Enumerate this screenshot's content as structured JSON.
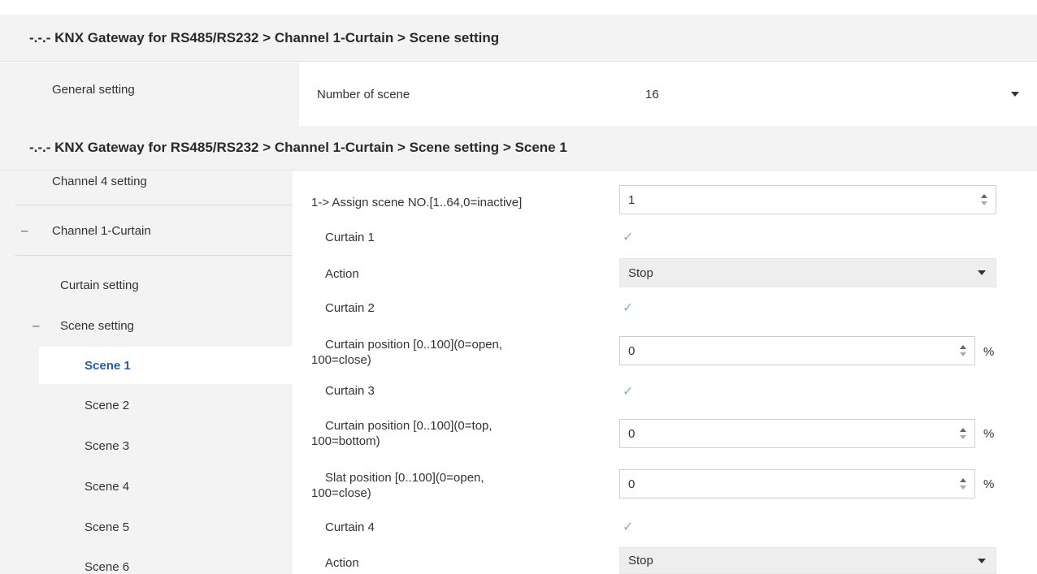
{
  "header1": "-.-.- KNX Gateway for RS485/RS232 > Channel 1-Curtain > Scene setting",
  "header2": "-.-.- KNX Gateway for RS485/RS232 > Channel 1-Curtain > Scene setting > Scene 1",
  "top_panel": {
    "sidebar_item": "General setting",
    "number_of_scene_label": "Number of scene",
    "number_of_scene_value": "16"
  },
  "sidebar": {
    "channel4": "Channel 4 setting",
    "channel1_toggle": "–",
    "channel1": "Channel 1-Curtain",
    "curtain_setting": "Curtain setting",
    "scene_setting_toggle": "–",
    "scene_setting": "Scene setting",
    "scenes": [
      "Scene 1",
      "Scene 2",
      "Scene 3",
      "Scene 4",
      "Scene 5",
      "Scene 6"
    ]
  },
  "params": {
    "assign_label": "1-> Assign scene NO.[1..64,0=inactive]",
    "assign_value": "1",
    "curtain1_label": "Curtain 1",
    "action1_label": "Action",
    "action1_value": "Stop",
    "curtain2_label": "Curtain 2",
    "c2_pos_label_1": "Curtain position [0..100](0=open,",
    "c2_pos_label_2": "100=close)",
    "c2_pos_value": "0",
    "curtain3_label": "Curtain 3",
    "c3_pos_label_1": "Curtain position [0..100](0=top,",
    "c3_pos_label_2": "100=bottom)",
    "c3_pos_value": "0",
    "slat_label_1": "Slat position [0..100](0=open,",
    "slat_label_2": "100=close)",
    "slat_value": "0",
    "curtain4_label": "Curtain 4",
    "action4_label": "Action",
    "action4_value": "Stop",
    "unit": "%",
    "check": "✓"
  }
}
